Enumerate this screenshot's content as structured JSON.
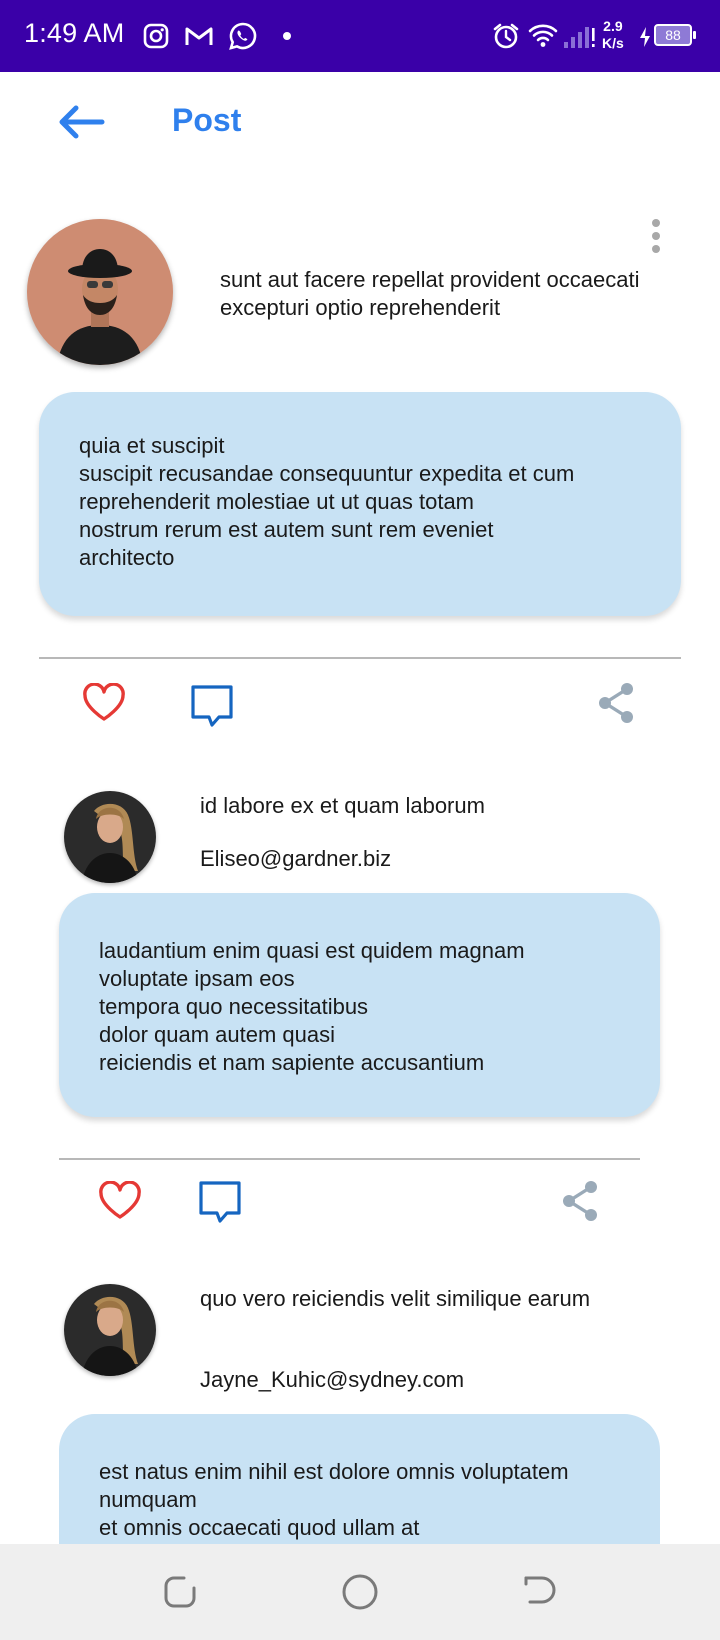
{
  "status_bar": {
    "time": "1:49 AM",
    "net_speed_value": "2.9",
    "net_speed_unit": "K/s",
    "battery": "88",
    "icons": [
      "instagram-icon",
      "gmail-icon",
      "whatsapp-icon",
      "dot-icon",
      "alarm-icon",
      "wifi-icon",
      "signal-icon",
      "charging-icon",
      "battery-icon"
    ]
  },
  "app_bar": {
    "title": "Post",
    "back_icon": "arrow-left-icon",
    "accent_color": "#2f80ed"
  },
  "post": {
    "title": "sunt aut facere repellat provident occaecati excepturi optio reprehenderit",
    "body": "quia et suscipit\nsuscipit recusandae consequuntur expedita et cum\nreprehenderit molestiae ut ut quas totam\nnostrum rerum est autem sunt rem eveniet\narchitecto",
    "actions": [
      "heart-icon",
      "comment-icon",
      "share-icon"
    ]
  },
  "comments": [
    {
      "name": "id labore ex et quam laborum",
      "email": "Eliseo@gardner.biz",
      "body": "laudantium enim quasi est quidem magnam\nvoluptate ipsam eos\ntempora quo necessitatibus\ndolor quam autem quasi\nreiciendis et nam sapiente accusantium"
    },
    {
      "name": "quo vero reiciendis velit similique earum",
      "email": "Jayne_Kuhic@sydney.com",
      "body": "est natus enim nihil est dolore omnis voluptatem\nnumquam\net omnis occaecati quod ullam at"
    }
  ],
  "colors": {
    "status_bar": "#3a00a8",
    "bubble": "#c8e2f4",
    "heart": "#e53935",
    "comment": "#1565c0",
    "share": "#9aaab8"
  },
  "nav_bar": {
    "icons": [
      "recents-icon",
      "home-icon",
      "back-nav-icon"
    ]
  }
}
